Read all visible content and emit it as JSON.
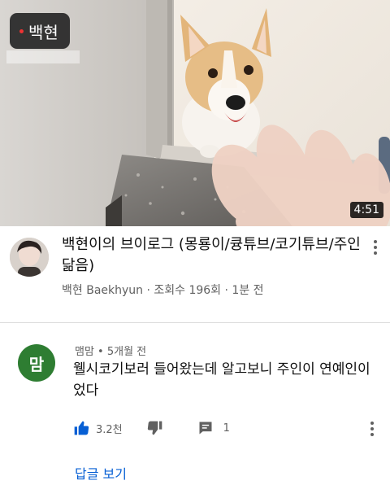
{
  "video": {
    "thumbnail_channel_tag": "백현",
    "duration": "4:51",
    "title": "백현이의 브이로그 (몽룡이/큥튜브/코기튜브/주인닮음)",
    "meta": "백현 Baekhyun · 조회수 196회 · 1분 전"
  },
  "comment": {
    "avatar_letter": "맘",
    "avatar_color": "#2e7d32",
    "author_time": "맴맘 • 5개월 전",
    "text": "웰시코기보러 들어왔는데 알고보니 주인이 연예인이었다",
    "like_count": "3.2천",
    "reply_count": "1",
    "view_replies": "답글 보기"
  },
  "icons": {
    "like": "thumbs-up-icon",
    "dislike": "thumbs-down-icon",
    "reply": "comment-icon",
    "more": "more-vertical-icon"
  },
  "colors": {
    "link": "#065fd4",
    "like_icon": "#065fd4",
    "secondary_text": "#606060"
  }
}
